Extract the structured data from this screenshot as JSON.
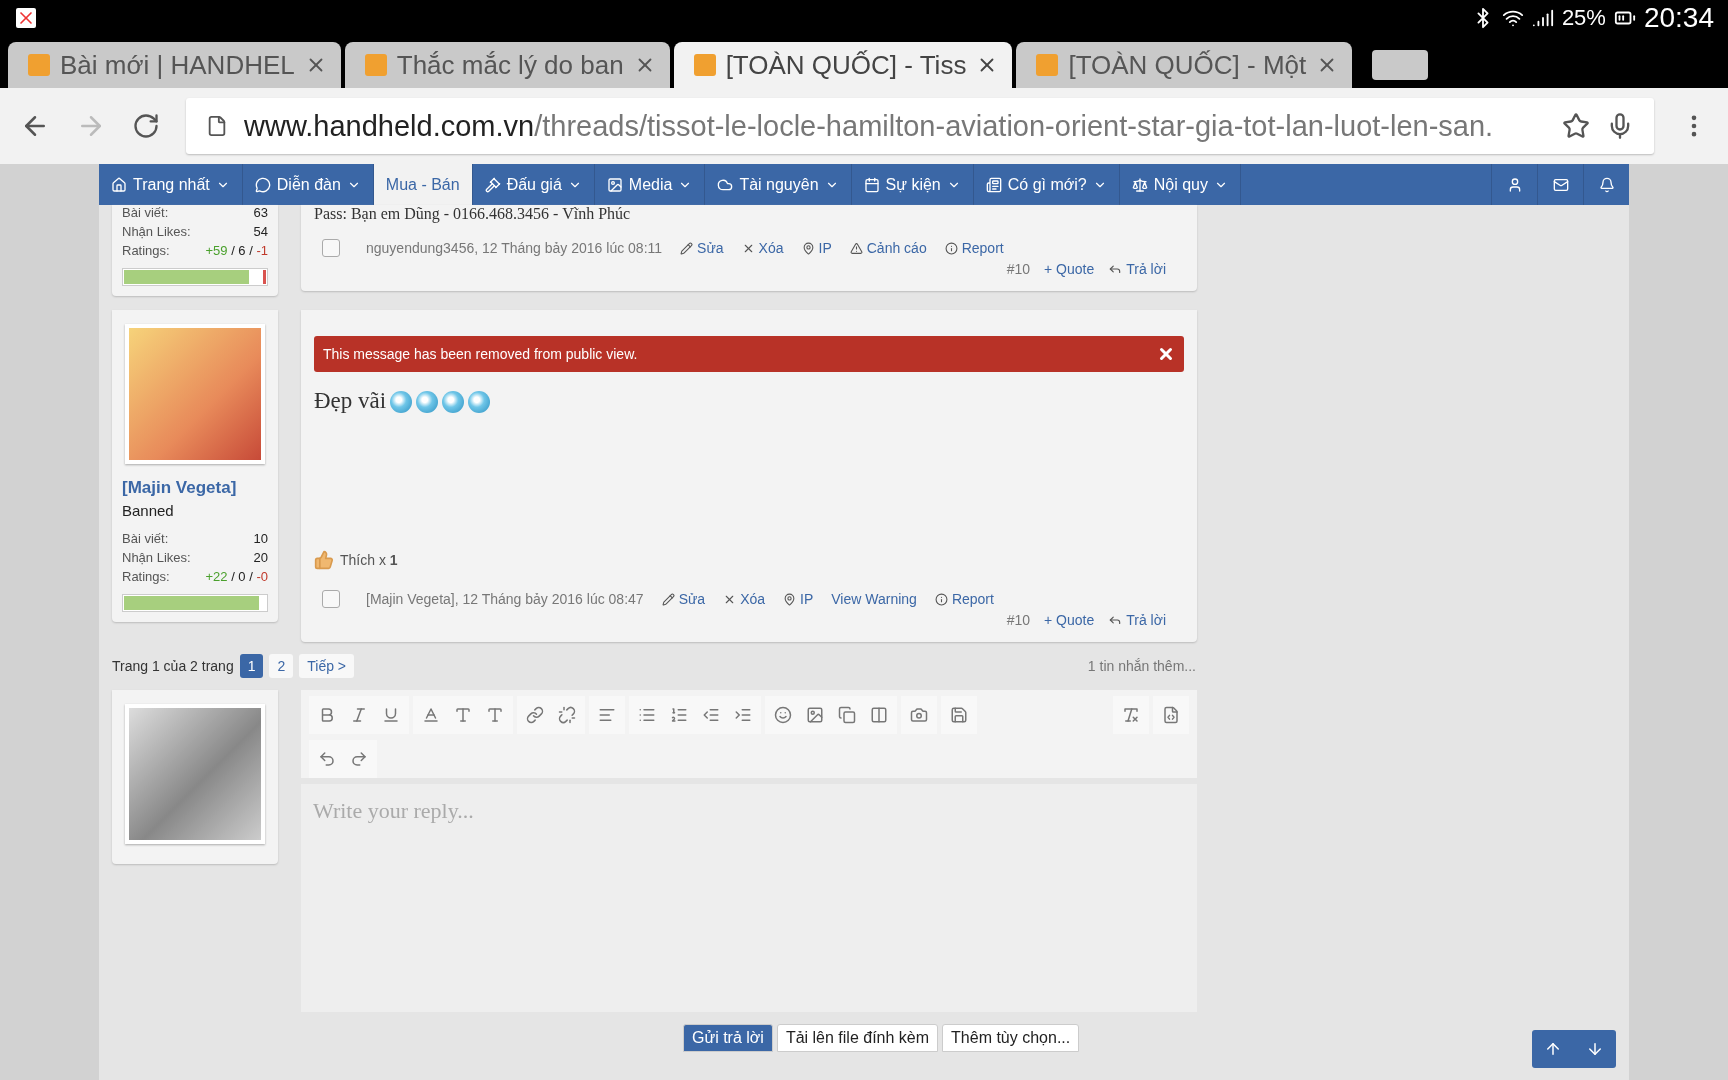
{
  "status_bar": {
    "battery": "25%",
    "time": "20:34"
  },
  "browser_tabs": [
    {
      "title": "Bài mới | HANDHEL",
      "selected": false
    },
    {
      "title": "Thắc mắc lý do ban",
      "selected": false
    },
    {
      "title": "[TOÀN QUỐC] - Tiss",
      "selected": true
    },
    {
      "title": "[TOÀN QUỐC] - Một",
      "selected": false
    }
  ],
  "address_bar": {
    "domain": "www.handheld.com.vn",
    "path": "/threads/tissot-le-locle-hamilton-aviation-orient-star-gia-tot-lan-luot-len-san."
  },
  "nav": [
    {
      "label": "Trang nhất",
      "kind": "home",
      "selected": false,
      "dropdown": true
    },
    {
      "label": "Diễn đàn",
      "kind": "chat",
      "selected": false,
      "dropdown": true
    },
    {
      "label": "Mua - Bán",
      "kind": "none",
      "selected": true,
      "dropdown": false
    },
    {
      "label": "Đấu giá",
      "kind": "gavel",
      "selected": false,
      "dropdown": true
    },
    {
      "label": "Media",
      "kind": "image",
      "selected": false,
      "dropdown": true
    },
    {
      "label": "Tài nguyên",
      "kind": "cloud",
      "selected": false,
      "dropdown": true
    },
    {
      "label": "Sự kiện",
      "kind": "calendar",
      "selected": false,
      "dropdown": true
    },
    {
      "label": "Có gì mới?",
      "kind": "news",
      "selected": false,
      "dropdown": true
    },
    {
      "label": "Nội quy",
      "kind": "scale",
      "selected": false,
      "dropdown": true
    }
  ],
  "posts": [
    {
      "avatar": false,
      "stats": [
        {
          "label": "Bài viết:",
          "value": "63"
        },
        {
          "label": "Nhận Likes:",
          "value": "54"
        }
      ],
      "ratings": {
        "label": "Ratings:",
        "parts": [
          {
            "text": "+59",
            "kind": "positive"
          },
          {
            "text": " / 6 / ",
            "kind": "neutral"
          },
          {
            "text": "-1",
            "kind": "negative"
          }
        ],
        "level": 0.93
      },
      "body": "Pass: Bạn em Dũng - 0166.468.3456 - Vĩnh Phúc",
      "emoji": false,
      "checked": false,
      "meta": "nguyendung3456, 12 Tháng bảy 2016 lúc 08:11",
      "actions": [
        {
          "label": "Sửa",
          "kind": "edit"
        },
        {
          "label": "Xóa",
          "kind": "delete"
        },
        {
          "label": "IP",
          "kind": "pin"
        },
        {
          "label": "Cảnh cáo",
          "kind": "warn"
        },
        {
          "label": "Report",
          "kind": "report"
        }
      ],
      "number": "#10",
      "quote": "+ Quote",
      "reply": "Trả lời"
    },
    {
      "avatar": true,
      "username": "[Majin Vegeta]",
      "user_title": "Banned",
      "stats": [
        {
          "label": "Bài viết:",
          "value": "10"
        },
        {
          "label": "Nhận Likes:",
          "value": "20"
        }
      ],
      "ratings": {
        "label": "Ratings:",
        "parts": [
          {
            "text": "+22",
            "kind": "positive"
          },
          {
            "text": " / 0 / ",
            "kind": "neutral"
          },
          {
            "text": "-0",
            "kind": "negative"
          }
        ],
        "level": 1
      },
      "notice": "This message has been removed from public view.",
      "body": "Đẹp vãi",
      "emoji": true,
      "likes": "Thích x **1**",
      "checked": false,
      "meta": "[Majin Vegeta], 12 Tháng bảy 2016 lúc 08:47",
      "actions": [
        {
          "label": "Sửa",
          "kind": "edit"
        },
        {
          "label": "Xóa",
          "kind": "delete"
        },
        {
          "label": "IP",
          "kind": "pin"
        },
        {
          "label": "View Warning",
          "kind": "link"
        },
        {
          "label": "Report",
          "kind": "report"
        }
      ],
      "number": "#10",
      "quote": "+ Quote",
      "reply": "Trả lời"
    }
  ],
  "pagination": {
    "label": "Trang 1 của 2 trang",
    "pages": [
      {
        "label": "1",
        "selected": true
      },
      {
        "label": "2",
        "selected": false
      }
    ],
    "next": "Tiếp >",
    "more": "1 tin nhắn thêm..."
  },
  "editor": {
    "placeholder": "Write your reply..."
  },
  "buttons": [
    {
      "label": "Gửi trả lời",
      "kind": "primary"
    },
    {
      "label": "Tải lên file đính kèm",
      "kind": "secondary"
    },
    {
      "label": "Thêm tùy chọn...",
      "kind": "secondary"
    }
  ]
}
